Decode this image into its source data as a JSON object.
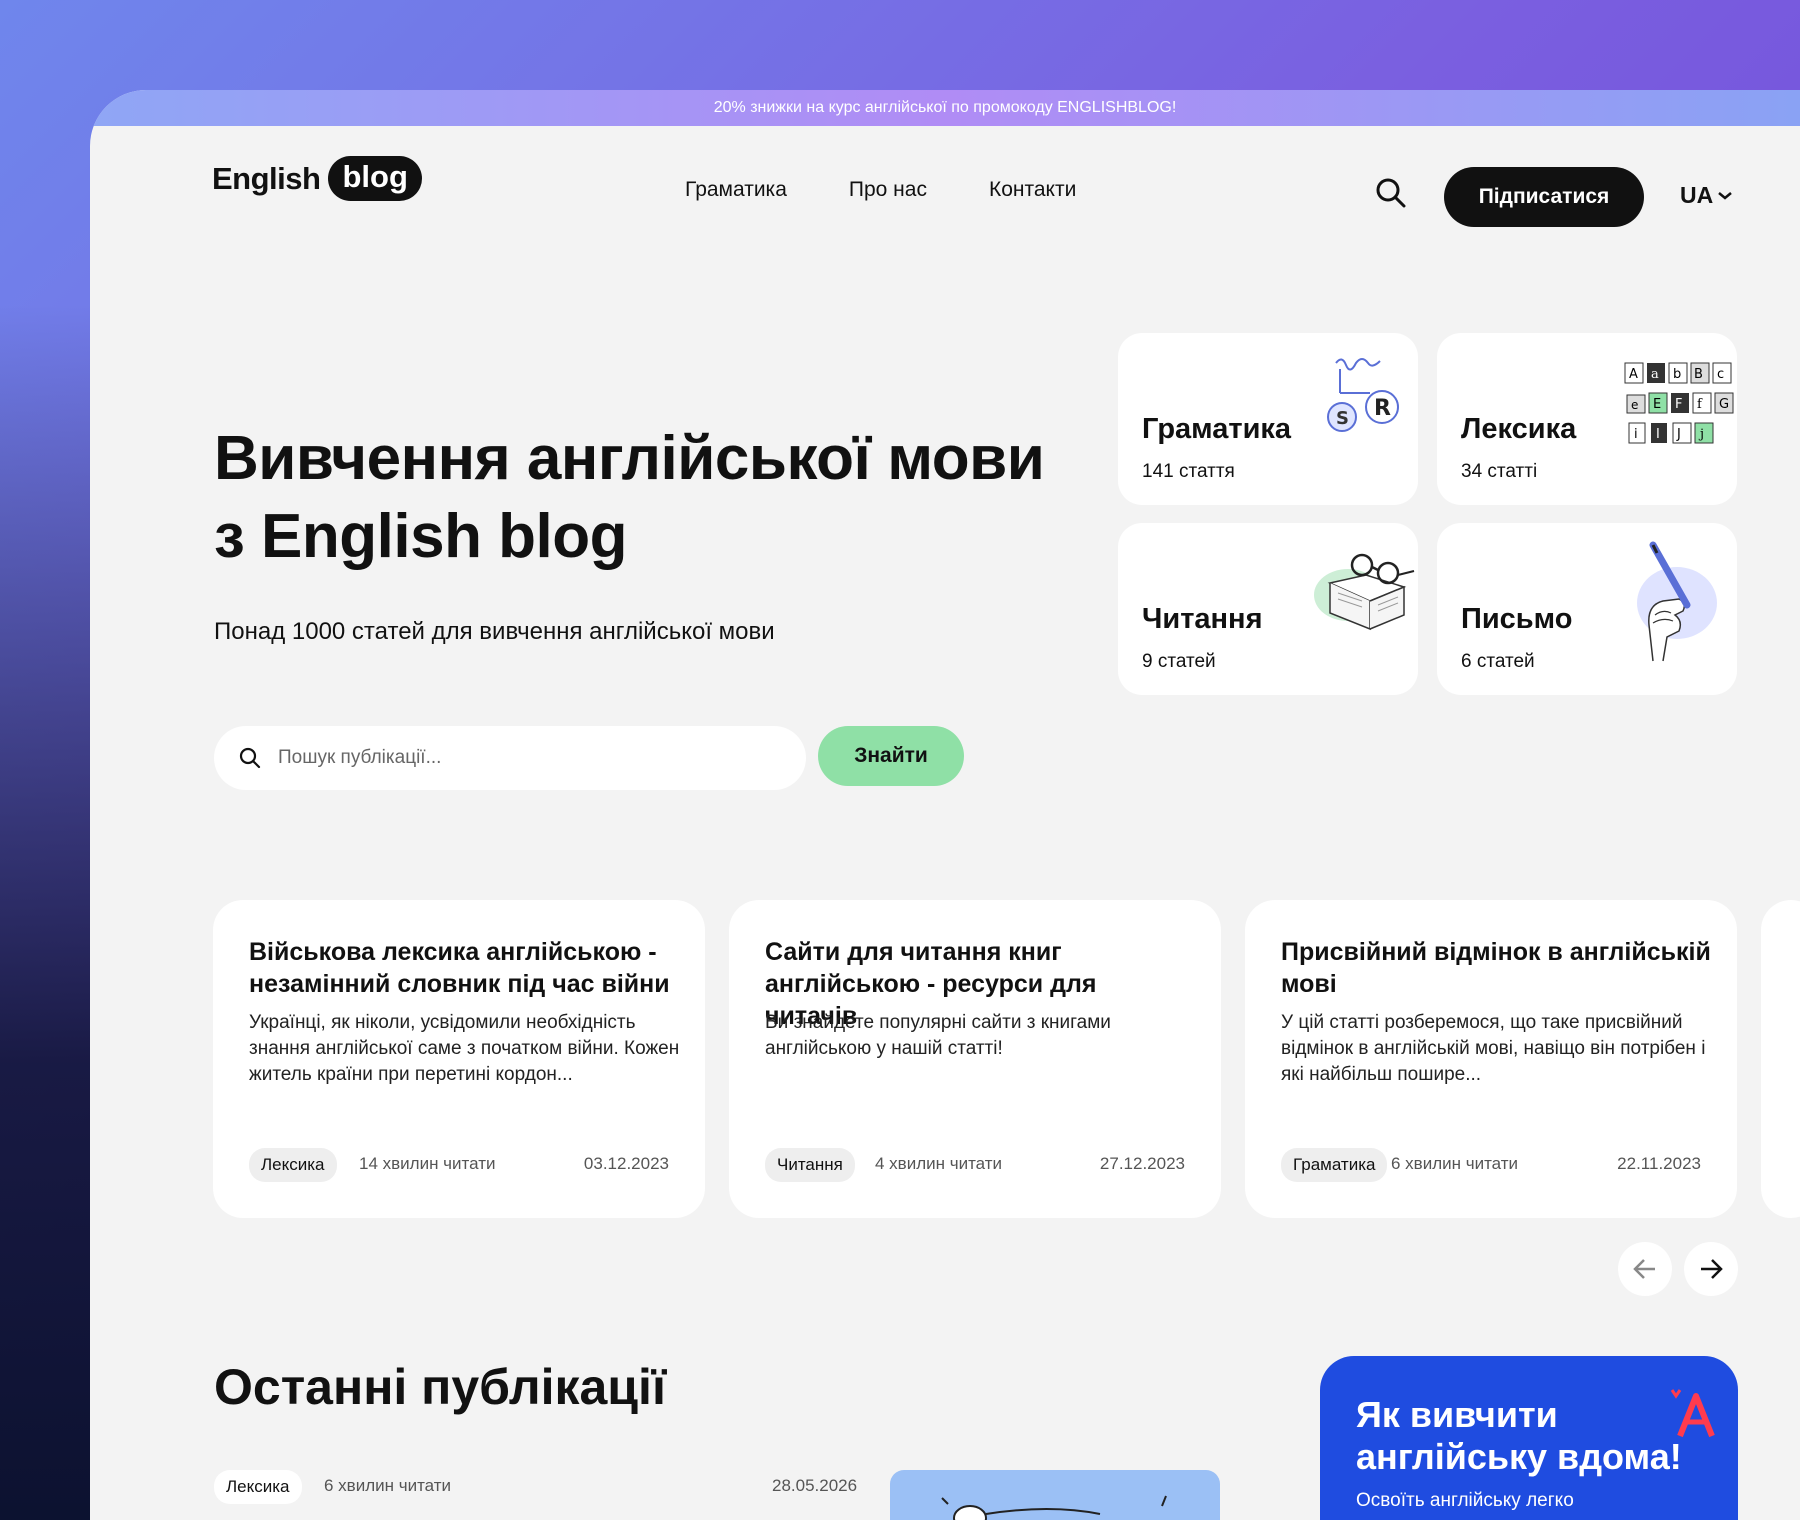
{
  "promo_bar": "20% знижки на курс англійської по промокоду ENGLISHBLOG!",
  "logo": {
    "text": "English",
    "pill": "blog"
  },
  "nav": [
    "Граматика",
    "Про нас",
    "Контакти"
  ],
  "header": {
    "subscribe": "Підписатися",
    "lang": "UA"
  },
  "hero": {
    "title_line1": "Вивчення англійської мови",
    "title_line2": "з English blog",
    "subtitle": "Понад 1000 статей для вивчення англійської мови",
    "search_placeholder": "Пошук публікації...",
    "find_button": "Знайти"
  },
  "categories": [
    {
      "name": "Граматика",
      "count": "141 стаття",
      "icon": "grammar-illustration"
    },
    {
      "name": "Лексика",
      "count": "34 статті",
      "icon": "letters-illustration"
    },
    {
      "name": "Читання",
      "count": "9 статей",
      "icon": "book-glasses-illustration"
    },
    {
      "name": "Письмо",
      "count": "6 статей",
      "icon": "hand-pen-illustration"
    }
  ],
  "articles": [
    {
      "title": "Військова лексика англійською - незамінний словник під час війни",
      "excerpt": "Українці, як ніколи, усвідомили необхідність знання англійської саме з початком війни. Кожен житель країни при перетині кордон...",
      "tag": "Лексика",
      "read_time": "14 хвилин читати",
      "date": "03.12.2023"
    },
    {
      "title": "Сайти для читання книг англійською - ресурси для читачів",
      "excerpt": "Ви знайдете популярні сайти з книгами англійською у нашій статті!",
      "tag": "Читання",
      "read_time": "4 хвилин читати",
      "date": "27.12.2023"
    },
    {
      "title": "Присвійний відмінок в англійській мові",
      "excerpt": "У цій статті розберемося, що таке присвійний відмінок в англійській мові, навіщо він потрібен і які найбільш пошире...",
      "tag": "Граматика",
      "read_time": "6 хвилин читати",
      "date": "22.11.2023"
    }
  ],
  "latest": {
    "title": "Останні публікації",
    "tag": "Лексика",
    "read_time": "6  хвилин читати",
    "date": "28.05.2026"
  },
  "promo_card": {
    "title": "Як вивчити англійську вдома!",
    "subtitle": "Освоїть англійську легко"
  },
  "colors": {
    "accent_green": "#8fe0a6",
    "promo_blue": "#1f4ce0",
    "dark": "#111111"
  }
}
